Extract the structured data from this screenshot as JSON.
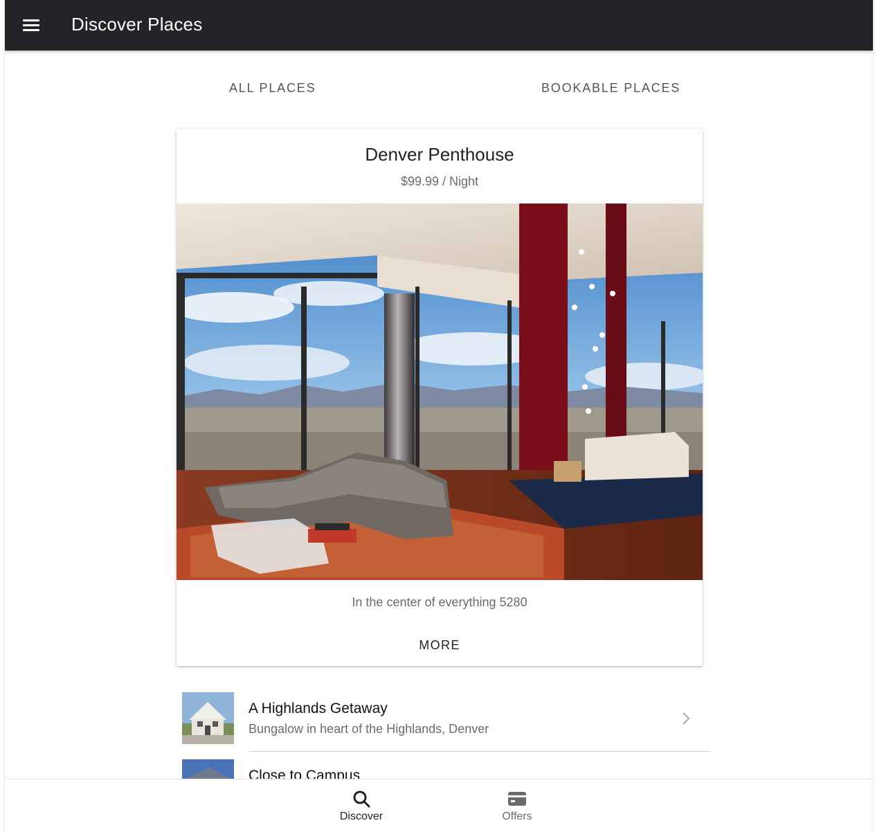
{
  "toolbar": {
    "title": "Discover Places",
    "menu_icon": "menu-icon"
  },
  "segments": [
    {
      "label": "ALL PLACES",
      "selected": true
    },
    {
      "label": "BOOKABLE PLACES",
      "selected": false
    }
  ],
  "featured": {
    "title": "Denver Penthouse",
    "price": "$99.99 / Night",
    "description": "In the center of everything 5280",
    "more_label": "MORE"
  },
  "places": [
    {
      "title": "A Highlands Getaway",
      "subtitle": "Bungalow in heart of the Highlands, Denver",
      "icon": "chevron-right-icon"
    },
    {
      "title": "Close to Campus",
      "subtitle": ""
    }
  ],
  "tabs": [
    {
      "label": "Discover",
      "icon": "search-icon",
      "selected": true
    },
    {
      "label": "Offers",
      "icon": "card-icon",
      "selected": false
    }
  ],
  "colors": {
    "toolbar_bg": "#222428",
    "tab_active": "#222222",
    "tab_inactive": "#6b6b6b"
  }
}
